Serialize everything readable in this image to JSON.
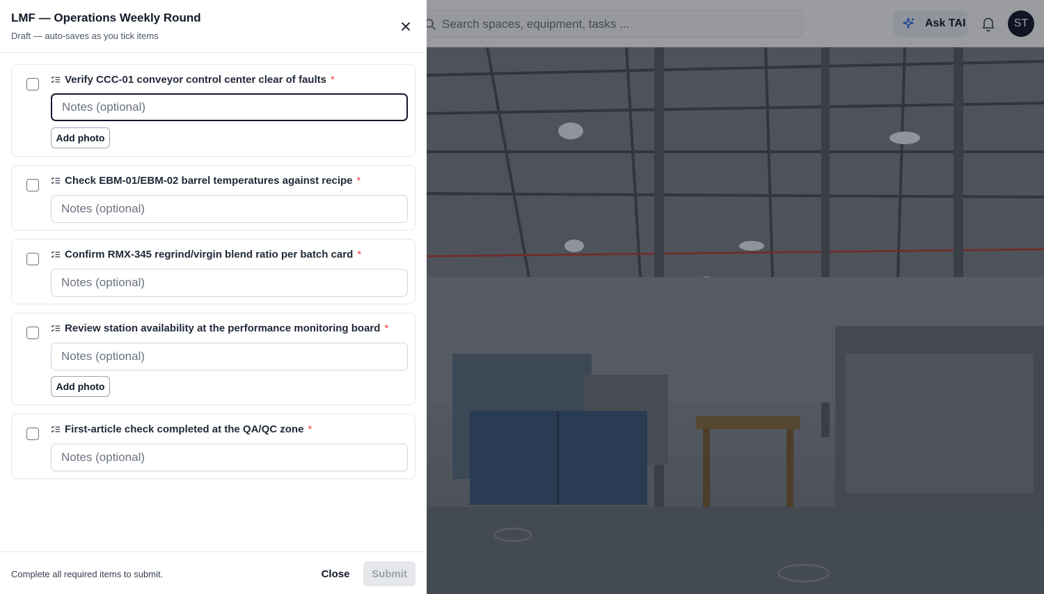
{
  "app": {
    "search_placeholder": "Search spaces, equipment, tasks ...",
    "ask_label": "Ask TAI",
    "avatar_initials": "ST"
  },
  "drawer": {
    "title": "LMF — Operations Weekly Round",
    "subtitle": "Draft — auto-saves as you tick items",
    "notes_placeholder": "Notes (optional)",
    "add_photo_label": "Add photo",
    "required_mark": "*",
    "items": [
      {
        "label": "Verify CCC-01 conveyor control center clear of faults",
        "required": true,
        "has_photo_button": true,
        "checked": false
      },
      {
        "label": "Check EBM-01/EBM-02 barrel temperatures against recipe",
        "required": true,
        "has_photo_button": false,
        "checked": false
      },
      {
        "label": "Confirm RMX-345 regrind/virgin blend ratio per batch card",
        "required": true,
        "has_photo_button": false,
        "checked": false
      },
      {
        "label": "Review station availability at the performance monitoring board",
        "required": true,
        "has_photo_button": true,
        "checked": false
      },
      {
        "label": "First-article check completed at the QA/QC zone",
        "required": true,
        "has_photo_button": false,
        "checked": false
      }
    ],
    "footer": {
      "hint": "Complete all required items to submit.",
      "close_label": "Close",
      "submit_label": "Submit"
    }
  },
  "colors": {
    "required": "#ef4444",
    "submit_disabled_bg": "#e5e7eb",
    "submit_disabled_text": "#9ca3af"
  }
}
